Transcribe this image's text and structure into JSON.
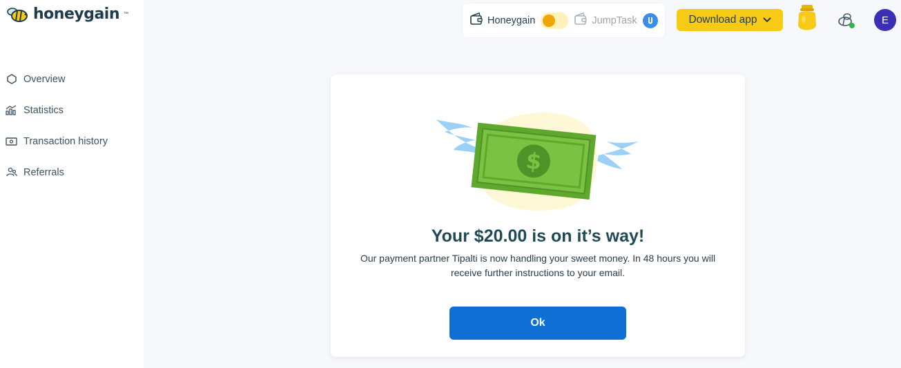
{
  "brand": {
    "name": "honeygain",
    "tm": "™"
  },
  "sidebar": {
    "items": [
      {
        "label": "Overview",
        "icon": "hexagon-icon"
      },
      {
        "label": "Statistics",
        "icon": "bar-chart-icon"
      },
      {
        "label": "Transaction history",
        "icon": "banknote-icon"
      },
      {
        "label": "Referrals",
        "icon": "users-icon"
      }
    ]
  },
  "topbar": {
    "honeygain_label": "Honeygain",
    "jumptask_label": "JumpTask",
    "download_label": "Download app",
    "avatar_initial": "E"
  },
  "modal": {
    "title": "Your $20.00 is on it’s way!",
    "text": "Our payment partner Tipalti is now handling your sweet money. In 48 hours you will receive further instructions to your email.",
    "ok_label": "Ok"
  },
  "colors": {
    "accent_yellow": "#f7cb15",
    "primary_blue": "#0f6fd4",
    "avatar_purple": "#3b2fb5",
    "money_green": "#7cc242"
  }
}
